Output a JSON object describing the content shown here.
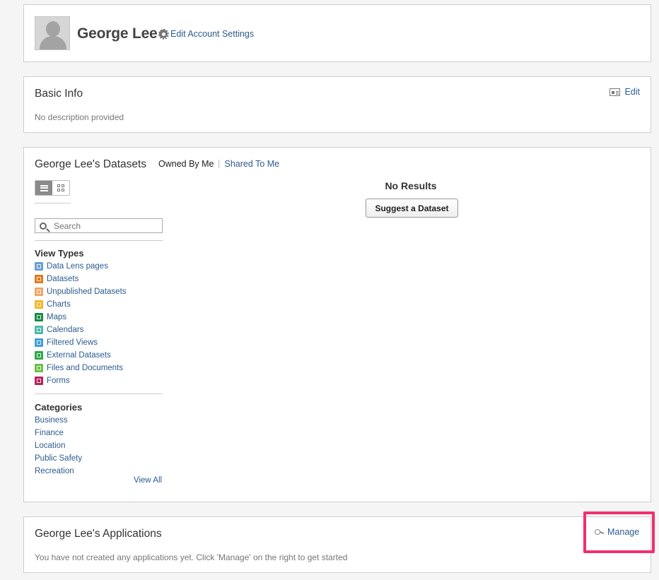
{
  "profile": {
    "name": "George Lee",
    "edit_settings_label": "Edit Account Settings"
  },
  "basic_info": {
    "title": "Basic Info",
    "edit_label": "Edit",
    "description": "No description provided"
  },
  "datasets": {
    "title": "George Lee's Datasets",
    "tabs": [
      {
        "label": "Owned By Me",
        "active": true
      },
      {
        "label": "Shared To Me",
        "active": false
      }
    ],
    "search_placeholder": "Search",
    "no_results": "No Results",
    "suggest_button": "Suggest a Dataset",
    "view_types_heading": "View Types",
    "view_types": [
      {
        "label": "Data Lens pages",
        "icon": "data-lens-icon",
        "color": "#6b9ed1"
      },
      {
        "label": "Datasets",
        "icon": "dataset-table-icon",
        "color": "#e07a1f"
      },
      {
        "label": "Unpublished Datasets",
        "icon": "unpublished-dataset-icon",
        "color": "#f0a56b"
      },
      {
        "label": "Charts",
        "icon": "chart-icon",
        "color": "#f2b52b"
      },
      {
        "label": "Maps",
        "icon": "map-icon",
        "color": "#1a8a46"
      },
      {
        "label": "Calendars",
        "icon": "calendar-icon",
        "color": "#4db8a8"
      },
      {
        "label": "Filtered Views",
        "icon": "filter-icon",
        "color": "#3f9fd9"
      },
      {
        "label": "External Datasets",
        "icon": "external-link-icon",
        "color": "#2ea84a"
      },
      {
        "label": "Files and Documents",
        "icon": "file-icon",
        "color": "#6cc04a"
      },
      {
        "label": "Forms",
        "icon": "form-icon",
        "color": "#b3245c"
      }
    ],
    "categories_heading": "Categories",
    "categories": [
      "Business",
      "Finance",
      "Location",
      "Public Safety",
      "Recreation"
    ],
    "view_all_label": "View All"
  },
  "applications": {
    "title": "George Lee's Applications",
    "manage_label": "Manage",
    "description": "You have not created any applications yet. Click 'Manage' on the right to get started"
  },
  "colors": {
    "link": "#2c5b8f",
    "highlight": "#f0306e"
  }
}
